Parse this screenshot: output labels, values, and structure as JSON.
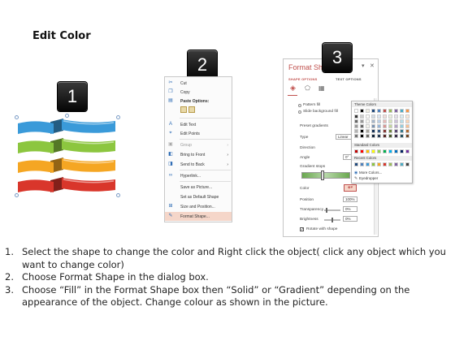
{
  "slide_title": "Edit Color",
  "step_numbers": [
    "1",
    "2",
    "3"
  ],
  "ribbon_colors": [
    "#3a9ad9",
    "#8cc63f",
    "#f5a623",
    "#d9362b"
  ],
  "context_menu": {
    "items": [
      {
        "label": "Cut",
        "icon": "scissors-icon",
        "enabled": true
      },
      {
        "label": "Copy",
        "icon": "copy-icon",
        "enabled": true
      },
      {
        "label": "Paste Options:",
        "icon": "paste-icon",
        "enabled": true
      },
      {
        "label": "Edit Text",
        "icon": "edit-text-icon",
        "enabled": true
      },
      {
        "label": "Edit Points",
        "icon": "edit-points-icon",
        "enabled": true
      },
      {
        "label": "Group",
        "icon": "group-icon",
        "enabled": false
      },
      {
        "label": "Bring to Front",
        "icon": "bring-front-icon",
        "enabled": true
      },
      {
        "label": "Send to Back",
        "icon": "send-back-icon",
        "enabled": true
      },
      {
        "label": "Hyperlink...",
        "icon": "hyperlink-icon",
        "enabled": true
      },
      {
        "label": "Save as Picture...",
        "icon": "",
        "enabled": true
      },
      {
        "label": "Set as Default Shape",
        "icon": "",
        "enabled": true
      },
      {
        "label": "Size and Position...",
        "icon": "size-position-icon",
        "enabled": true
      },
      {
        "label": "Format Shape...",
        "icon": "format-shape-icon",
        "enabled": true
      }
    ]
  },
  "format_pane": {
    "title": "Format Shape",
    "tabs": [
      "SHAPE OPTIONS",
      "TEXT OPTIONS"
    ],
    "pattern_fill": "Pattern fill",
    "slide_background_fill": "Slide background fill",
    "preset_gradients": "Preset gradients",
    "type_label": "Type",
    "type_value": "Linear",
    "direction_label": "Direction",
    "angle_label": "Angle",
    "angle_value": "0°",
    "gradient_stops": "Gradient stops",
    "color_label": "Color",
    "position_label": "Position",
    "position_value": "100%",
    "transparency_label": "Transparency",
    "transparency_value": "0%",
    "brightness_label": "Brightness",
    "brightness_value": "0%",
    "rotate_label": "Rotate with shape"
  },
  "color_picker": {
    "theme_colors": "Theme Colors",
    "standard_colors": "Standard Colors",
    "recent_colors": "Recent Colors",
    "more_colors": "More Colors...",
    "eyedropper": "Eyedropper",
    "theme_top_row": [
      "#ffffff",
      "#000000",
      "#eeece1",
      "#1f497d",
      "#4f81bd",
      "#c0504d",
      "#9bbb59",
      "#8064a2",
      "#4bacc6",
      "#f79646"
    ],
    "standard_row": [
      "#c00000",
      "#ff0000",
      "#ffc000",
      "#ffff00",
      "#92d050",
      "#00b050",
      "#00b0f0",
      "#0070c0",
      "#002060",
      "#7030a0"
    ],
    "recent_row": [
      "#1f497d",
      "#4f81bd",
      "#3a9ad9",
      "#8cc63f",
      "#f5a623",
      "#d9362b",
      "#9bbb59",
      "#8064a2",
      "#4bacc6",
      "#404040"
    ]
  },
  "instructions": [
    {
      "num": "1.",
      "text": "Select the shape to change the color and Right click the object( click any object which you want to change color)"
    },
    {
      "num": "2.",
      "text": "Choose Format Shape in the dialog box."
    },
    {
      "num": "3.",
      "text": "Choose “Fill” in the Format Shape box then “Solid” or “Gradient” depending on the appearance of the object. Change colour as shown in the picture."
    }
  ]
}
